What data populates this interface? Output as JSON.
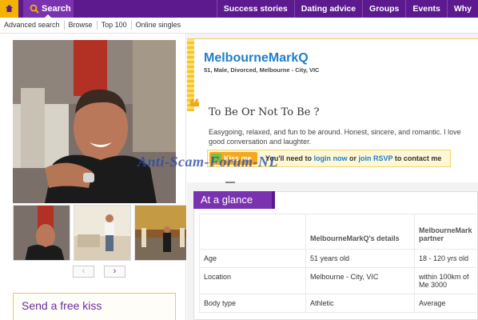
{
  "nav": {
    "search_label": "Search",
    "items": [
      "Success stories",
      "Dating advice",
      "Groups",
      "Events",
      "Why"
    ]
  },
  "subnav": {
    "items": [
      "Advanced search",
      "Browse",
      "Top 100",
      "Online singles"
    ]
  },
  "left": {
    "send_kiss_title": "Send a free kiss",
    "thumb_prev": "‹",
    "thumb_next": "›"
  },
  "profile": {
    "username": "MelbourneMarkQ",
    "subline": "51, Male, Divorced, Melbourne - City, VIC",
    "quote_mark": "❝",
    "headline": "To Be Or Not To Be ?",
    "about": "Easygoing, relaxed, and fun to be around. Honest, sincere, and romantic. I love good conversation and laughter.",
    "kiss_button": "Kiss me",
    "contact_prefix": "You'll need to",
    "contact_login": "login now",
    "contact_or": "or",
    "contact_join": "join RSVP",
    "contact_suffix": "to contact me"
  },
  "watermark": "Anti-Scam-Forum-NL",
  "glance": {
    "tab": "At a glance",
    "col_details": "MelbourneMarkQ's details",
    "col_partner": "MelbourneMark partner",
    "rows": [
      {
        "label": "Age",
        "details": "51 years old",
        "partner": "18 - 120 yrs old"
      },
      {
        "label": "Location",
        "details": "Melbourne - City, VIC",
        "partner": "within 100km of Me 3000"
      },
      {
        "label": "Body type",
        "details": "Athletic",
        "partner": "Average"
      }
    ]
  },
  "colors": {
    "nav_purple": "#5c1a8e",
    "accent_purple": "#7b32b0",
    "home_yellow": "#f2b400",
    "link_blue": "#1f7fcb",
    "kiss_orange": "#f5a81c"
  }
}
